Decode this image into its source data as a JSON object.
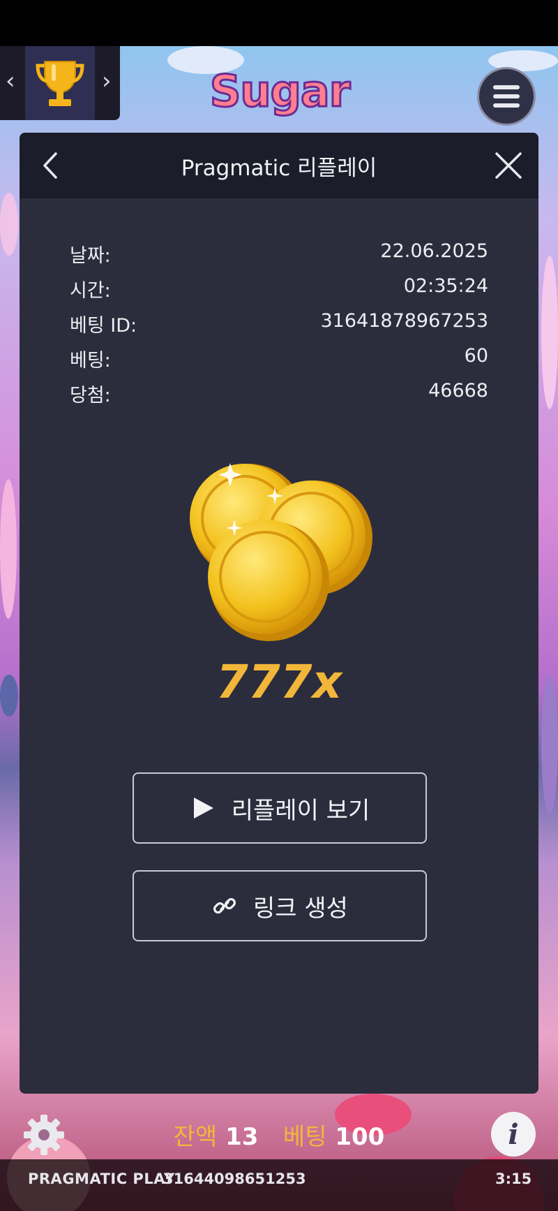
{
  "game": {
    "logo_text": "Sugar"
  },
  "modal": {
    "title": "Pragmatic 리플레이",
    "info": [
      {
        "label": "날짜:",
        "value": "22.06.2025"
      },
      {
        "label": "시간:",
        "value": "02:35:24"
      },
      {
        "label": "베팅 ID:",
        "value": "31641878967253"
      },
      {
        "label": "베팅:",
        "value": "60"
      },
      {
        "label": "당첨:",
        "value": "46668"
      }
    ],
    "multiplier": "777x",
    "watch_replay_label": "리플레이 보기",
    "create_link_label": "링크 생성"
  },
  "bottom_bar": {
    "balance_label": "잔액",
    "balance_value": "13",
    "bet_label": "베팅",
    "bet_value": "100"
  },
  "footer": {
    "brand": "PRAGMATIC PLAY",
    "round_id": "31644098651253",
    "time": "3:15"
  },
  "colors": {
    "modal_bg": "#2b2d3d",
    "header_bg": "#1c1d2a",
    "accent_gold": "#f2b63a"
  },
  "icons": [
    "trophy-icon",
    "chevron-left-icon",
    "chevron-right-icon",
    "hamburger-menu-icon",
    "back-arrow-icon",
    "close-icon",
    "coins-icon",
    "play-icon",
    "link-icon",
    "gear-icon",
    "info-icon"
  ]
}
